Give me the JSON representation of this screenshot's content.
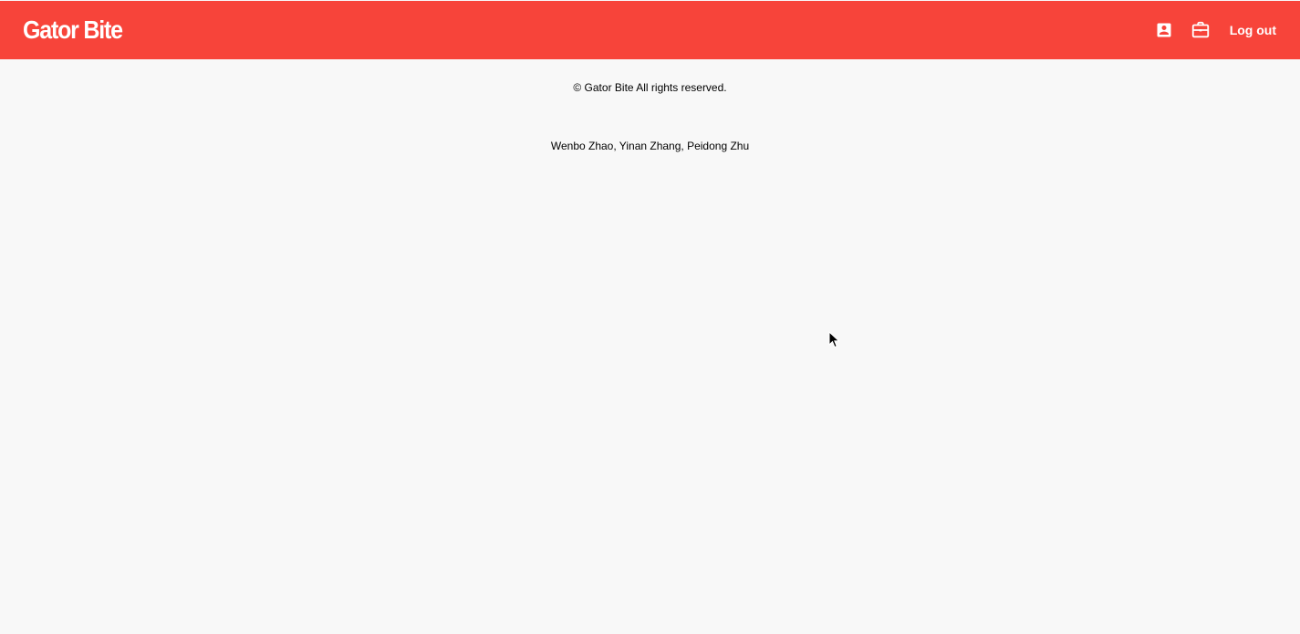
{
  "header": {
    "brand": "Gator Bite",
    "profile_icon": "account-box-icon",
    "tools_icon": "briefcase-icon",
    "logout_label": "Log out",
    "accent_color": "#f7443a"
  },
  "footer": {
    "copyright": "© Gator Bite All rights reserved.",
    "authors": "Wenbo Zhao, Yinan Zhang, Peidong Zhu"
  },
  "page": {
    "background_color": "#f8f8f8"
  }
}
